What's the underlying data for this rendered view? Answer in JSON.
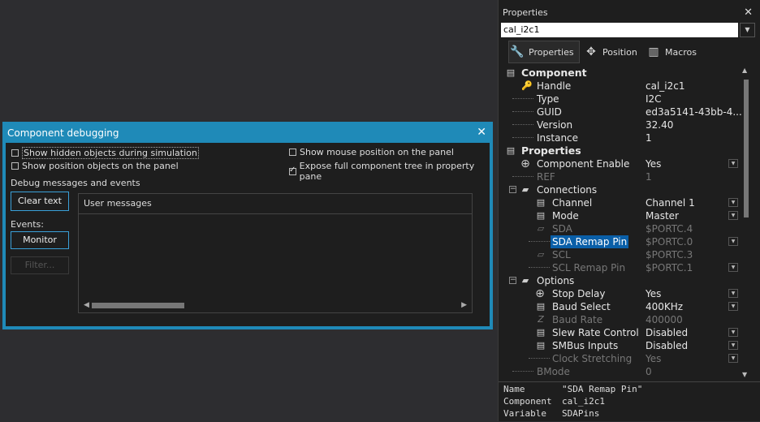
{
  "debug_dialog": {
    "title": "Component debugging",
    "close": "✕",
    "checkboxes": [
      {
        "label": "Show hidden objects during simulation",
        "checked": false
      },
      {
        "label": "Show position objects on the panel",
        "checked": false
      },
      {
        "label": "Show mouse position on the panel",
        "checked": false
      },
      {
        "label": "Expose full component tree in property pane",
        "checked": true
      }
    ],
    "section_label": "Debug messages and events",
    "clear_button": "Clear text",
    "events_label": "Events:",
    "monitor_button": "Monitor",
    "filter_button": "Filter...",
    "messages_header": "User messages"
  },
  "properties": {
    "title": "Properties",
    "close": "✕",
    "component_name": "cal_i2c1",
    "tabs": [
      {
        "label": "Properties",
        "icon": "wrench-icon"
      },
      {
        "label": "Position",
        "icon": "move-icon"
      },
      {
        "label": "Macros",
        "icon": "macro-icon"
      }
    ],
    "rows": [
      {
        "name": "Component",
        "value": "",
        "kind": "category"
      },
      {
        "name": "Handle",
        "value": "cal_i2c1"
      },
      {
        "name": "Type",
        "value": "I2C"
      },
      {
        "name": "GUID",
        "value": "ed3a5141-43bb-4..."
      },
      {
        "name": "Version",
        "value": "32.40"
      },
      {
        "name": "Instance",
        "value": "1"
      },
      {
        "name": "Properties",
        "value": "",
        "kind": "category"
      },
      {
        "name": "Component Enable",
        "value": "Yes"
      },
      {
        "name": "REF",
        "value": "1",
        "disabled": true
      },
      {
        "name": "Connections",
        "value": ""
      },
      {
        "name": "Channel",
        "value": "Channel 1"
      },
      {
        "name": "Mode",
        "value": "Master"
      },
      {
        "name": "SDA",
        "value": "$PORTC.4",
        "disabled": true
      },
      {
        "name": "SDA Remap Pin",
        "value": "$PORTC.0",
        "selected": true
      },
      {
        "name": "SCL",
        "value": "$PORTC.3",
        "disabled": true
      },
      {
        "name": "SCL Remap Pin",
        "value": "$PORTC.1",
        "disabled": true
      },
      {
        "name": "Options",
        "value": ""
      },
      {
        "name": "Stop Delay",
        "value": "Yes"
      },
      {
        "name": "Baud Select",
        "value": "400KHz"
      },
      {
        "name": "Baud Rate",
        "value": "400000",
        "disabled": true
      },
      {
        "name": "Slew Rate Control",
        "value": "Disabled"
      },
      {
        "name": "SMBus Inputs",
        "value": "Disabled"
      },
      {
        "name": "Clock Stretching",
        "value": "Yes",
        "disabled": true
      },
      {
        "name": "BMode",
        "value": "0",
        "disabled": true
      }
    ],
    "info": [
      {
        "key": "Name",
        "value": "\"SDA Remap Pin\""
      },
      {
        "key": "Component",
        "value": "cal_i2c1"
      },
      {
        "key": "Variable",
        "value": "SDAPins"
      }
    ]
  }
}
